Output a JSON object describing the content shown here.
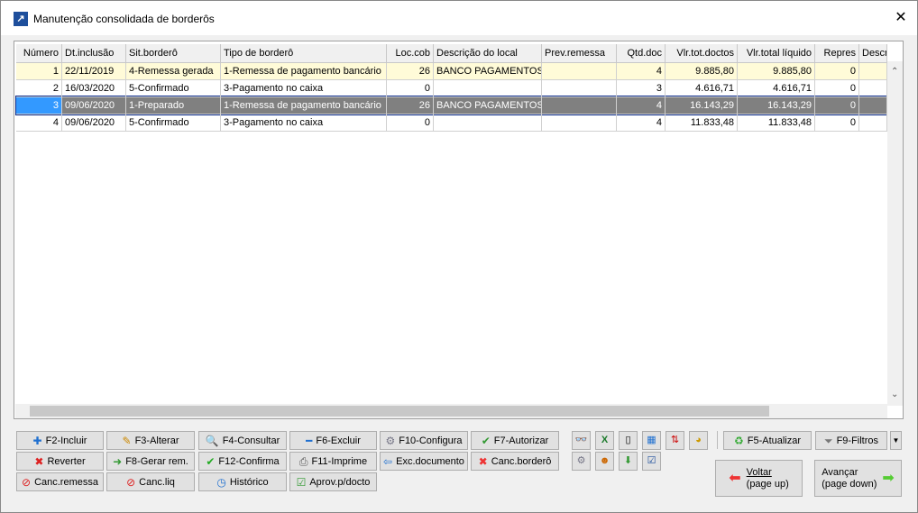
{
  "window": {
    "title": "Manutenção consolidada de borderôs"
  },
  "grid": {
    "columns": [
      "Número",
      "Dt.inclusão",
      "Sit.borderô",
      "Tipo de borderô",
      "Loc.cob",
      "Descrição do local",
      "Prev.remessa",
      "Qtd.doc",
      "Vlr.tot.doctos",
      "Vlr.total líquido",
      "Repres",
      "Descr"
    ],
    "rows": [
      [
        "1",
        "22/11/2019",
        "4-Remessa gerada",
        "1-Remessa de pagamento bancário",
        "26",
        "BANCO PAGAMENTOS",
        "",
        "4",
        "9.885,80",
        "9.885,80",
        "0",
        ""
      ],
      [
        "2",
        "16/03/2020",
        "5-Confirmado",
        "3-Pagamento no caixa",
        "0",
        "",
        "",
        "3",
        "4.616,71",
        "4.616,71",
        "0",
        ""
      ],
      [
        "3",
        "09/06/2020",
        "1-Preparado",
        "1-Remessa de pagamento bancário",
        "26",
        "BANCO PAGAMENTOS",
        "",
        "4",
        "16.143,29",
        "16.143,29",
        "0",
        ""
      ],
      [
        "4",
        "09/06/2020",
        "5-Confirmado",
        "3-Pagamento no caixa",
        "0",
        "",
        "",
        "4",
        "11.833,48",
        "11.833,48",
        "0",
        ""
      ]
    ],
    "selected_row": 3
  },
  "buttons": [
    [
      "F2-Incluir",
      "F3-Alterar",
      "F4-Consultar",
      "F6-Excluir",
      "F10-Configura",
      "F7-Autorizar"
    ],
    [
      "Reverter",
      "F8-Gerar rem.",
      "F12-Confirma",
      "F11-Imprime",
      "Exc.documento",
      "Canc.borderô"
    ],
    [
      "Canc.remessa",
      "Canc.liq",
      "Histórico",
      "Aprov.p/docto"
    ]
  ],
  "toolbar": {
    "refresh": "F5-Atualizar",
    "filters": "F9-Filtros",
    "back": "Voltar",
    "back_sub": "(page up)",
    "next": "Avançar",
    "next_sub": "(page down)"
  },
  "colors": {
    "selected_row": "#808080",
    "highlight_row": "#fffbd8",
    "selection_border": "#0a2a8a"
  }
}
